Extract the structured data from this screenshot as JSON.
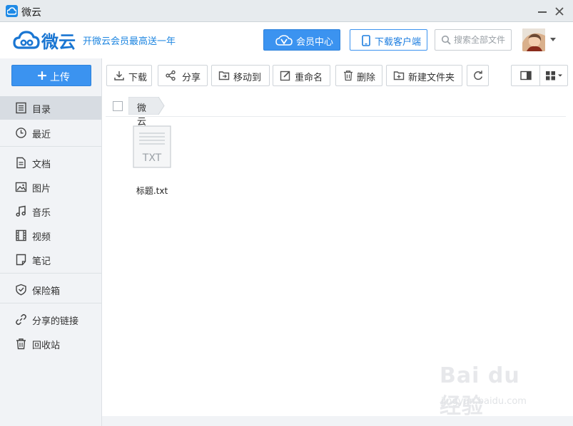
{
  "window": {
    "title": "微云"
  },
  "header": {
    "logo_text": "微云",
    "promo": "开微云会员最高送一年",
    "vip_label": "会员中心",
    "download_client_label": "下载客户端",
    "search_placeholder": "搜索全部文件"
  },
  "sidebar": {
    "upload_label": "上传",
    "items": [
      {
        "label": "目录",
        "icon": "list-icon",
        "active": true
      },
      {
        "label": "最近",
        "icon": "clock-icon"
      },
      {
        "label": "文档",
        "icon": "document-icon"
      },
      {
        "label": "图片",
        "icon": "image-icon"
      },
      {
        "label": "音乐",
        "icon": "music-icon"
      },
      {
        "label": "视频",
        "icon": "film-icon"
      },
      {
        "label": "笔记",
        "icon": "note-icon"
      },
      {
        "label": "保险箱",
        "icon": "shield-icon"
      },
      {
        "label": "分享的链接",
        "icon": "link-icon"
      },
      {
        "label": "回收站",
        "icon": "trash-icon"
      }
    ]
  },
  "toolbar": {
    "download": "下载",
    "share": "分享",
    "move_to": "移动到",
    "rename": "重命名",
    "delete": "删除",
    "new_folder": "新建文件夹"
  },
  "breadcrumb": {
    "root": "微云"
  },
  "files": [
    {
      "name": "标题.txt",
      "type_label": "TXT"
    }
  ],
  "watermark": {
    "text": "Bai du 经验",
    "sub": "jingyan.baidu.com"
  },
  "colors": {
    "accent": "#3b93f0",
    "brand": "#1a76d2",
    "sidebar_bg": "#f1f3f6"
  }
}
